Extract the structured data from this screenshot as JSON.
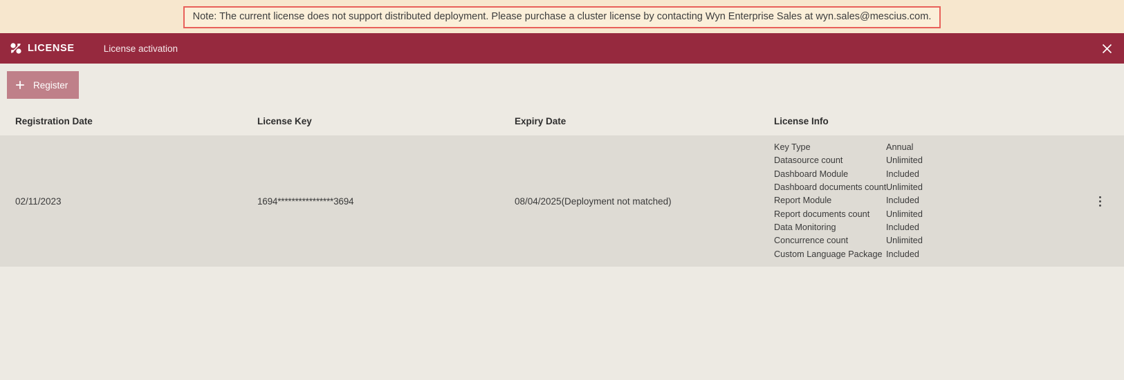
{
  "notice": {
    "text": "Note: The current license does not support distributed deployment. Please purchase a cluster license by contacting Wyn Enterprise Sales at wyn.sales@mescius.com.",
    "border_color": "#E8605A",
    "background_color": "#FBEFD9"
  },
  "header": {
    "brand_icon": "license-puzzle-icon",
    "title": "LICENSE",
    "subtitle": "License activation",
    "close_icon": "close-icon",
    "background_color": "#96293E"
  },
  "toolbar": {
    "register_label": "Register",
    "register_icon": "plus-icon",
    "register_color": "#BF8089"
  },
  "table": {
    "columns": [
      "Registration Date",
      "License Key",
      "Expiry Date",
      "License Info"
    ],
    "rows": [
      {
        "registration_date": "02/11/2023",
        "license_key": "1694****************3694",
        "expiry_date": "08/04/2025(Deployment not matched)",
        "row_menu_icon": "kebab-menu-icon",
        "license_info": [
          {
            "label": "Key Type",
            "value": "Annual"
          },
          {
            "label": "Datasource count",
            "value": "Unlimited"
          },
          {
            "label": "Dashboard Module",
            "value": "Included"
          },
          {
            "label": "Dashboard documents count",
            "value": "Unlimited"
          },
          {
            "label": "Report Module",
            "value": "Included"
          },
          {
            "label": "Report documents count",
            "value": "Unlimited"
          },
          {
            "label": "Data Monitoring",
            "value": "Included"
          },
          {
            "label": "Concurrence count",
            "value": "Unlimited"
          },
          {
            "label": "Custom Language Package",
            "value": "Included"
          }
        ]
      }
    ],
    "row_background": "#DEDBD4",
    "page_background": "#EDEAE3"
  }
}
